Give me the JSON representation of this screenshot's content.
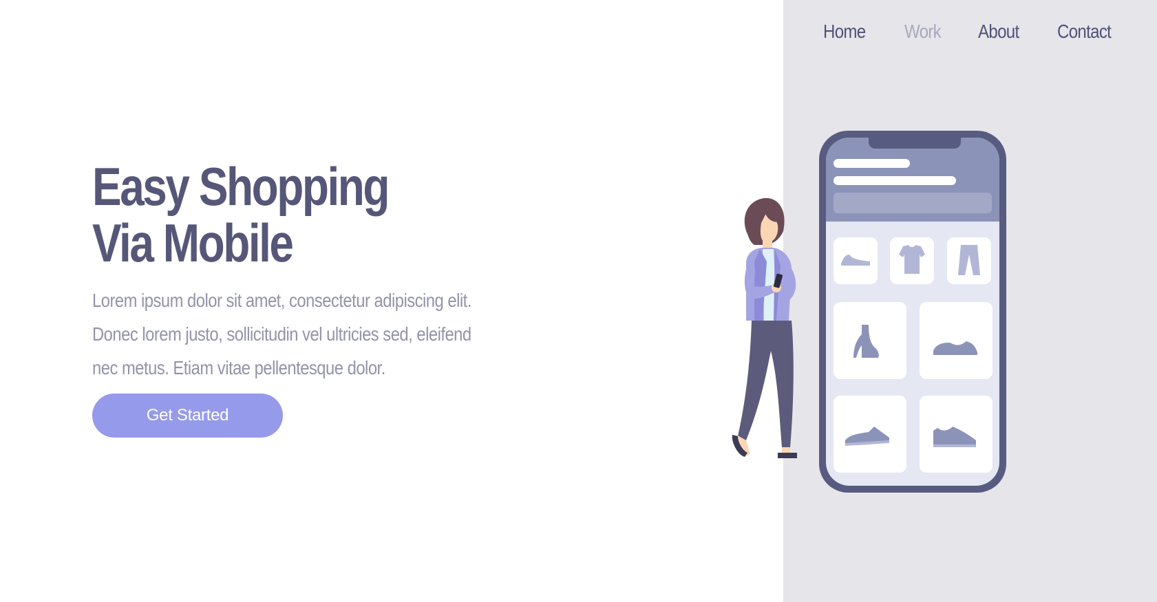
{
  "nav": {
    "items": [
      {
        "label": "Home",
        "active": false
      },
      {
        "label": "Work",
        "active": true
      },
      {
        "label": "About",
        "active": false
      },
      {
        "label": "Contact",
        "active": false
      }
    ]
  },
  "hero": {
    "title_line1": "Easy Shopping",
    "title_line2": "Via Mobile",
    "description": "Lorem ipsum dolor sit amet, consectetur adipiscing elit. Donec lorem justo, sollicitudin vel ultricies sed, eleifend nec metus. Etiam vitae pellentesque dolor.",
    "cta_label": "Get Started"
  },
  "illustration": {
    "icons": [
      "flat-shoe-icon",
      "tshirt-icon",
      "pants-icon",
      "boot-icon",
      "sneaker-icon",
      "sneaker-icon",
      "sneaker-icon"
    ]
  },
  "colors": {
    "primary": "#565778",
    "accent": "#959aeb",
    "panel_bg": "#e5e5ea",
    "muted_text": "#9293a8",
    "active_nav": "#a7a8bc"
  }
}
